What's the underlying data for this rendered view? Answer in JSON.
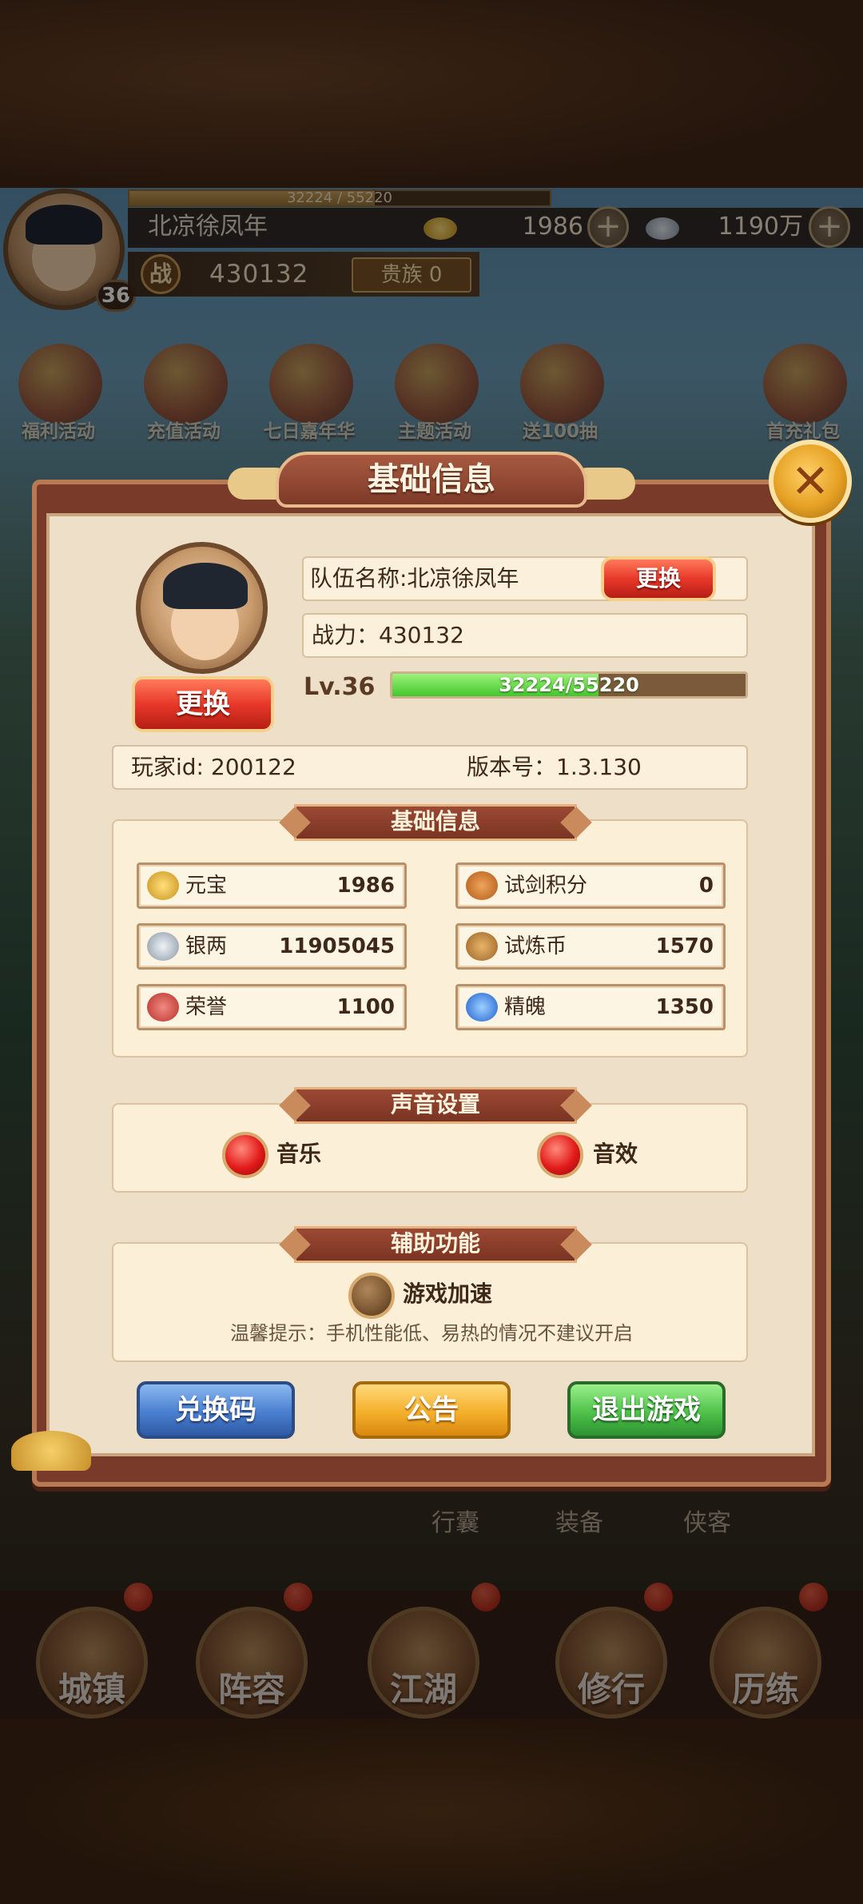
{
  "topbar": {
    "avatar_level": "36",
    "xp_text": "32224 / 55220",
    "xp_fraction": 0.5836,
    "player_name": "北凉徐凤年",
    "gold": "1986",
    "silver": "1190万",
    "plus": "+",
    "power_icon": "战",
    "power": "430132",
    "noble": "贵族 0"
  },
  "activities": [
    {
      "label": "福利活动"
    },
    {
      "label": "充值活动"
    },
    {
      "label": "七日嘉年华"
    },
    {
      "label": "主题活动"
    },
    {
      "label": "送100抽"
    },
    {
      "label": "首充礼包"
    }
  ],
  "bottom_nav": {
    "items": [
      "城镇",
      "阵容",
      "江湖",
      "修行",
      "历练"
    ],
    "sub_labels": [
      "行囊",
      "装备",
      "侠客"
    ]
  },
  "panel": {
    "title": "基础信息",
    "close_glyph": "✕",
    "avatar_change": "更换",
    "team_name": "队伍名称:北凉徐凤年",
    "team_change": "更换",
    "power": "战力：430132",
    "level": "Lv.36",
    "exp_text": "32224/55220",
    "exp_fraction": 0.5836,
    "player_id": "玩家id: 200122",
    "version": "版本号：1.3.130",
    "basic_section": {
      "title": "基础信息",
      "items": [
        {
          "name": "元宝",
          "value": "1986",
          "icon": "gold-ingot-icon",
          "color": "#f1b62c"
        },
        {
          "name": "试剑积分",
          "value": "0",
          "icon": "sword-points-icon",
          "color": "#d2782a"
        },
        {
          "name": "银两",
          "value": "11905045",
          "icon": "silver-ingot-icon",
          "color": "#9aa7b5"
        },
        {
          "name": "试炼币",
          "value": "1570",
          "icon": "trial-coin-icon",
          "color": "#c2893a"
        },
        {
          "name": "荣誉",
          "value": "1100",
          "icon": "honor-icon",
          "color": "#d4504a"
        },
        {
          "name": "精魄",
          "value": "1350",
          "icon": "spirit-icon",
          "color": "#3a7fe0"
        }
      ]
    },
    "sound_section": {
      "title": "声音设置",
      "music": "音乐",
      "music_on": true,
      "sfx": "音效",
      "sfx_on": true
    },
    "assist_section": {
      "title": "辅助功能",
      "speedup": "游戏加速",
      "speedup_on": false,
      "tip": "温馨提示：手机性能低、易热的情况不建议开启"
    },
    "buttons": {
      "redeem": "兑换码",
      "notice": "公告",
      "exit": "退出游戏"
    }
  }
}
